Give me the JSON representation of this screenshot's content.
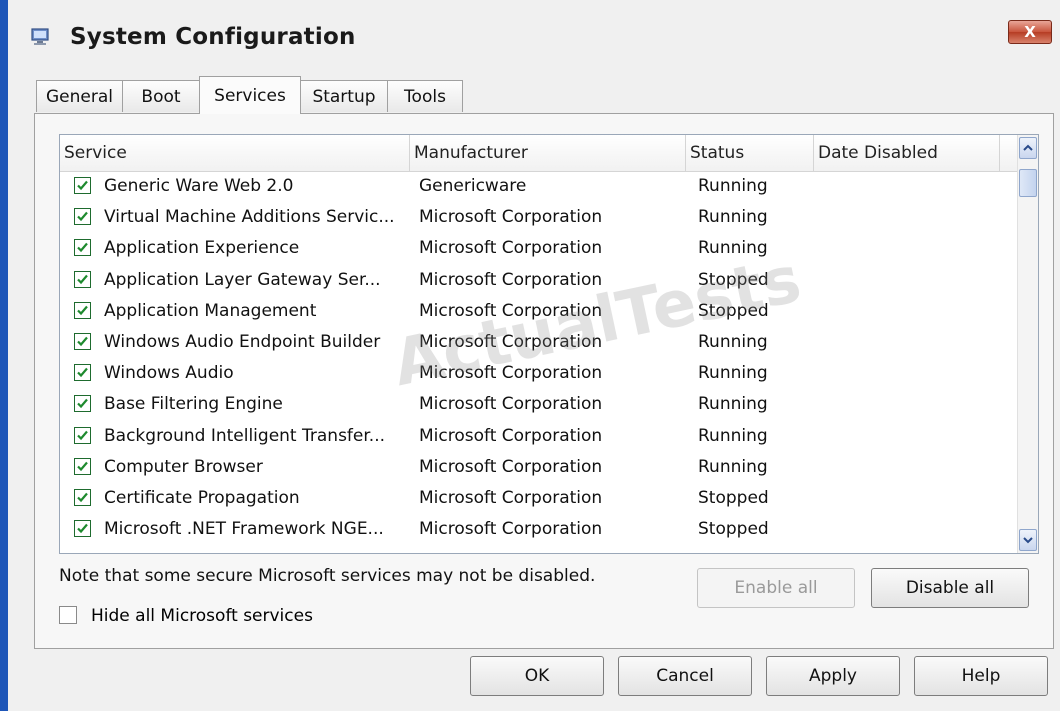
{
  "window": {
    "title": "System Configuration",
    "close_label": "X"
  },
  "tabs": [
    {
      "label": "General"
    },
    {
      "label": "Boot"
    },
    {
      "label": "Services",
      "active": true
    },
    {
      "label": "Startup"
    },
    {
      "label": "Tools"
    }
  ],
  "table": {
    "columns": [
      "Service",
      "Manufacturer",
      "Status",
      "Date Disabled"
    ],
    "rows": [
      {
        "checked": true,
        "service": "Generic Ware Web 2.0",
        "manufacturer": "Genericware",
        "status": "Running",
        "date_disabled": ""
      },
      {
        "checked": true,
        "service": "Virtual Machine Additions Servic...",
        "manufacturer": "Microsoft Corporation",
        "status": "Running",
        "date_disabled": ""
      },
      {
        "checked": true,
        "service": "Application Experience",
        "manufacturer": "Microsoft Corporation",
        "status": "Running",
        "date_disabled": ""
      },
      {
        "checked": true,
        "service": "Application Layer Gateway Ser...",
        "manufacturer": "Microsoft Corporation",
        "status": "Stopped",
        "date_disabled": ""
      },
      {
        "checked": true,
        "service": "Application Management",
        "manufacturer": "Microsoft Corporation",
        "status": "Stopped",
        "date_disabled": ""
      },
      {
        "checked": true,
        "service": "Windows Audio Endpoint Builder",
        "manufacturer": "Microsoft Corporation",
        "status": "Running",
        "date_disabled": ""
      },
      {
        "checked": true,
        "service": "Windows Audio",
        "manufacturer": "Microsoft Corporation",
        "status": "Running",
        "date_disabled": ""
      },
      {
        "checked": true,
        "service": "Base Filtering Engine",
        "manufacturer": "Microsoft Corporation",
        "status": "Running",
        "date_disabled": ""
      },
      {
        "checked": true,
        "service": "Background Intelligent Transfer...",
        "manufacturer": "Microsoft Corporation",
        "status": "Running",
        "date_disabled": ""
      },
      {
        "checked": true,
        "service": "Computer Browser",
        "manufacturer": "Microsoft Corporation",
        "status": "Running",
        "date_disabled": ""
      },
      {
        "checked": true,
        "service": "Certificate Propagation",
        "manufacturer": "Microsoft Corporation",
        "status": "Stopped",
        "date_disabled": ""
      },
      {
        "checked": true,
        "service": "Microsoft .NET Framework NGE...",
        "manufacturer": "Microsoft Corporation",
        "status": "Stopped",
        "date_disabled": ""
      }
    ]
  },
  "watermark": "ActualTests",
  "note": "Note that some secure Microsoft services may not be disabled.",
  "hide_microsoft": {
    "label": "Hide all Microsoft services",
    "checked": false
  },
  "buttons": {
    "enable_all": "Enable all",
    "disable_all": "Disable all",
    "ok": "OK",
    "cancel": "Cancel",
    "apply": "Apply",
    "help": "Help"
  },
  "colors": {
    "checkmark": "#1e8a2e",
    "title_border": "#1e56b8"
  },
  "icons": {
    "title": "monitor-config-icon",
    "close": "close-icon",
    "check": "checkmark-icon",
    "scroll_up": "chevron-up-icon",
    "scroll_down": "chevron-down-icon"
  }
}
